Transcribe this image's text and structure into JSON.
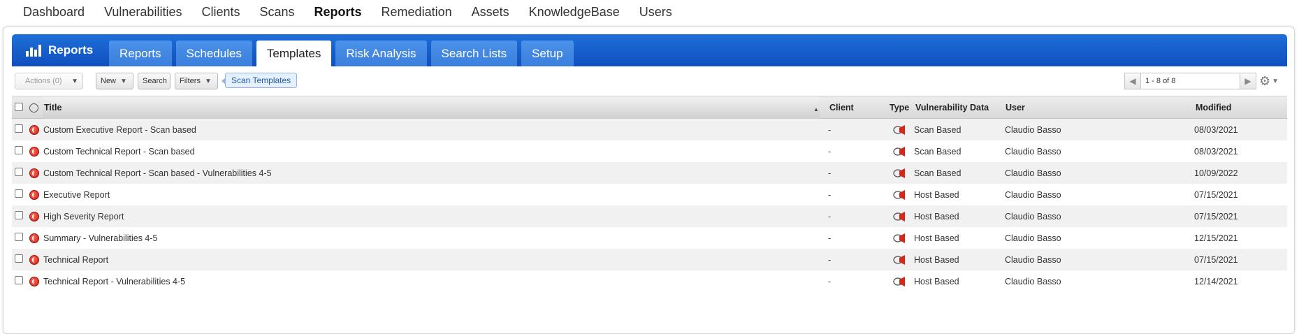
{
  "topnav": {
    "items": [
      "Dashboard",
      "Vulnerabilities",
      "Clients",
      "Scans",
      "Reports",
      "Remediation",
      "Assets",
      "KnowledgeBase",
      "Users"
    ],
    "active": "Reports"
  },
  "appbar": {
    "title": "Reports",
    "tabs": [
      "Reports",
      "Schedules",
      "Templates",
      "Risk Analysis",
      "Search Lists",
      "Setup"
    ],
    "active_tab": "Templates"
  },
  "toolbar": {
    "actions_label": "Actions (0)",
    "new_label": "New",
    "search_label": "Search",
    "filters_label": "Filters",
    "filter_tag": "Scan Templates",
    "pager_text": "1 - 8 of 8"
  },
  "table": {
    "columns": {
      "title": "Title",
      "client": "Client",
      "type": "Type",
      "vuln_data": "Vulnerability Data",
      "user": "User",
      "modified": "Modified"
    },
    "rows": [
      {
        "title": "Custom Executive Report - Scan based",
        "client": "-",
        "vuln_data": "Scan Based",
        "user": "Claudio Basso",
        "modified": "08/03/2021"
      },
      {
        "title": "Custom Technical Report - Scan based",
        "client": "-",
        "vuln_data": "Scan Based",
        "user": "Claudio Basso",
        "modified": "08/03/2021"
      },
      {
        "title": "Custom Technical Report - Scan based - Vulnerabilities 4-5",
        "client": "-",
        "vuln_data": "Scan Based",
        "user": "Claudio Basso",
        "modified": "10/09/2022"
      },
      {
        "title": "Executive Report",
        "client": "-",
        "vuln_data": "Host Based",
        "user": "Claudio Basso",
        "modified": "07/15/2021"
      },
      {
        "title": "High Severity Report",
        "client": "-",
        "vuln_data": "Host Based",
        "user": "Claudio Basso",
        "modified": "07/15/2021"
      },
      {
        "title": "Summary - Vulnerabilities 4-5",
        "client": "-",
        "vuln_data": "Host Based",
        "user": "Claudio Basso",
        "modified": "12/15/2021"
      },
      {
        "title": "Technical Report",
        "client": "-",
        "vuln_data": "Host Based",
        "user": "Claudio Basso",
        "modified": "07/15/2021"
      },
      {
        "title": "Technical Report - Vulnerabilities 4-5",
        "client": "-",
        "vuln_data": "Host Based",
        "user": "Claudio Basso",
        "modified": "12/14/2021"
      }
    ]
  },
  "colors": {
    "brand_blue": "#1559cc",
    "tab_blue": "#3a7fdc",
    "filter_tag_bg": "#e6f0fc",
    "globe_red": "#d6281a"
  },
  "icons": {
    "app": "bar-chart-icon",
    "row_globe": "globe-icon",
    "type": "report-type-icon",
    "settings": "gear-icon"
  }
}
